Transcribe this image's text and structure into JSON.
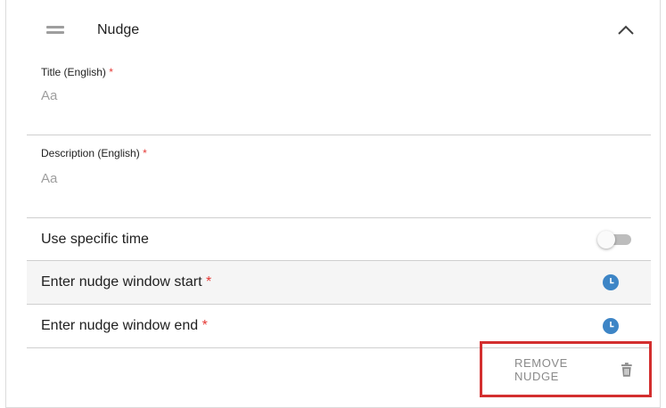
{
  "section": {
    "title": "Nudge",
    "drag_icon": "drag-handle-icon",
    "collapse_icon": "chevron-up-icon"
  },
  "fields": {
    "title": {
      "label": "Title (English)",
      "required_mark": "*",
      "placeholder": "Aa",
      "value": ""
    },
    "description": {
      "label": "Description (English)",
      "required_mark": "*",
      "placeholder": "Aa",
      "value": ""
    }
  },
  "specific_time": {
    "label": "Use specific time",
    "toggle_on": false
  },
  "window_start": {
    "label": "Enter nudge window start",
    "required_mark": "*",
    "icon": "clock-icon"
  },
  "window_end": {
    "label": "Enter nudge window end",
    "required_mark": "*",
    "icon": "clock-icon"
  },
  "remove": {
    "label": "REMOVE NUDGE",
    "icon": "trash-icon"
  },
  "colors": {
    "required": "#e53935",
    "clock_blue": "#3d85c6",
    "highlight_red": "#d32f2f",
    "row_shade": "#f5f5f5"
  }
}
